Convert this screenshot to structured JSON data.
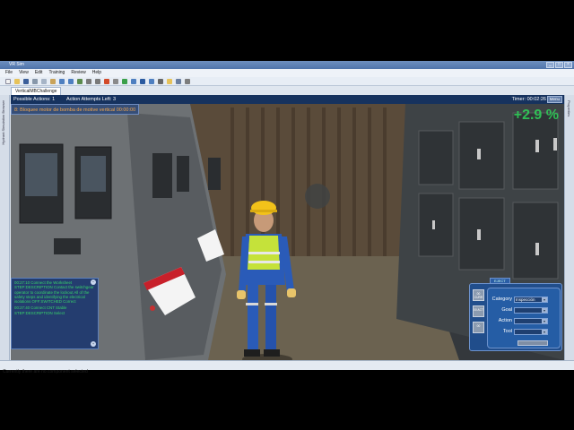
{
  "window": {
    "title": "VR Sim",
    "controls": [
      "_",
      "□",
      "×"
    ]
  },
  "menu": [
    "File",
    "View",
    "Edit",
    "Training",
    "Review",
    "Help"
  ],
  "tab": {
    "label": "VerticalMBChallenge"
  },
  "left_sidebar": {
    "label": "Hydrant Simulation Browser"
  },
  "right_sidebar": {
    "label": "Properties"
  },
  "sim": {
    "possible_actions": "Possible Actions: 1",
    "attempts_left": "Action Attempts Left: 3",
    "timer": "Timer: 00:02:26",
    "menu_button": "Menu",
    "task": "8: Bloquee motor de bomba de motive vertical 00:00:00",
    "score": "+2.9 %"
  },
  "log": {
    "entries": [
      "00:27:10 Connect the Worksheet STEP:DESCRIPTION Contact the switchgear operator to coordinate the lockout All of the safety steps and identifying the electrical isolations OFF:SWITCHED Correct",
      "00:27:40 Connect CNT Stable STEP:DESCRIPTION Select"
    ]
  },
  "panel": {
    "tab_label": "EJECT",
    "side_buttons": [
      "00 CURR",
      "00 ACT",
      "00"
    ],
    "category_label": "Category",
    "category_value": "Inspección",
    "goal_label": "Goal",
    "goal_value": "",
    "action_label": "Action",
    "action_value": "",
    "tool_label": "Tool",
    "tool_value": ""
  },
  "status": {
    "text": "Currently there are no component selected"
  },
  "colors": {
    "sim_bar": "#16325e",
    "task_text": "#f4a64a",
    "score": "#2fd65a",
    "log_text": "#37d46a"
  }
}
